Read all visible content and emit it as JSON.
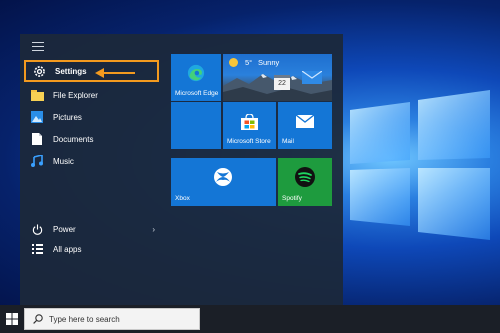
{
  "start_menu": {
    "items": [
      {
        "label": "Settings",
        "icon": "gear-icon"
      },
      {
        "label": "File Explorer",
        "icon": "folder-icon"
      },
      {
        "label": "Pictures",
        "icon": "pictures-icon"
      },
      {
        "label": "Documents",
        "icon": "document-icon"
      },
      {
        "label": "Music",
        "icon": "music-icon"
      }
    ],
    "power_label": "Power",
    "all_apps_label": "All apps"
  },
  "tiles": {
    "edge": "Microsoft Edge",
    "weather_temp": "5°",
    "weather_condition": "Sunny",
    "calendar_day": "22",
    "store": "Microsoft Store",
    "mail": "Mail",
    "xbox": "Xbox",
    "spotify": "Spotify"
  },
  "taskbar": {
    "search_placeholder": "Type here to search"
  },
  "colors": {
    "highlight": "#f39a1f",
    "tile_blue": "#1476d6",
    "spotify_green": "#1e9b3e"
  }
}
